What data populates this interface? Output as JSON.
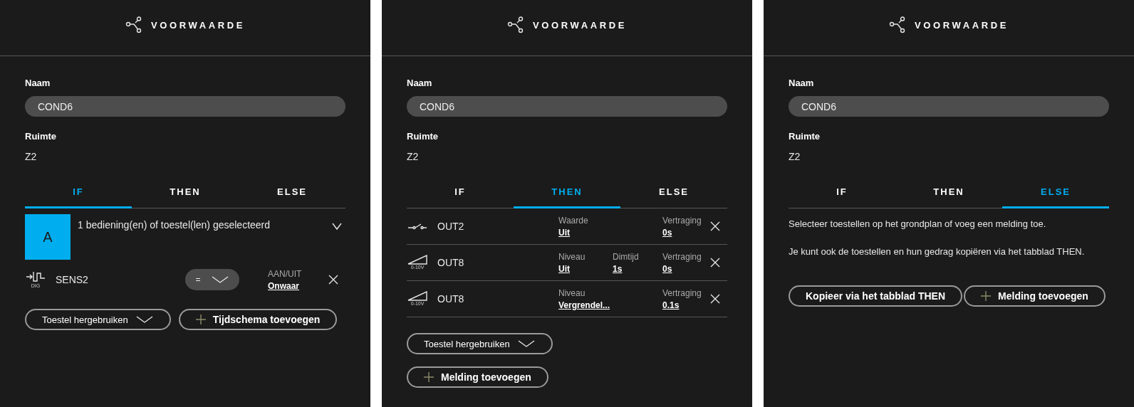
{
  "panels": [
    {
      "kind": "if",
      "title": "VOORWAARDE",
      "name_label": "Naam",
      "name": "COND6",
      "room_label": "Ruimte",
      "room": "Z2",
      "tabs": [
        {
          "label": "IF",
          "selected": true
        },
        {
          "label": "THEN",
          "selected": false
        },
        {
          "label": "ELSE",
          "selected": false
        }
      ],
      "group": {
        "badge": "A",
        "title": "1 bediening(en) of toestel(len) geselecteerd"
      },
      "conditions": [
        {
          "kind": "digital",
          "icon_label": "DIG",
          "name": "SENS2",
          "operator": "=",
          "value_label": "AAN/UIT",
          "value": "Onwaar"
        }
      ],
      "buttons": [
        {
          "kind": "dropdown",
          "label": "Toestel hergebruiken"
        },
        {
          "kind": "add",
          "label": "Tijdschema toevoegen"
        }
      ]
    },
    {
      "kind": "then",
      "title": "VOORWAARDE",
      "name_label": "Naam",
      "name": "COND6",
      "room_label": "Ruimte",
      "room": "Z2",
      "tabs": [
        {
          "label": "IF",
          "selected": false
        },
        {
          "label": "THEN",
          "selected": true
        },
        {
          "label": "ELSE",
          "selected": false
        }
      ],
      "actions": [
        {
          "kind": "switch",
          "name": "OUT2",
          "primary": {
            "label": "Waarde",
            "value": "Uit"
          },
          "delay": {
            "label": "Vertraging",
            "value": "0s"
          }
        },
        {
          "kind": "dimmer",
          "icon_label": "0-10V",
          "name": "OUT8",
          "primary": {
            "label": "Niveau",
            "value": "Uit"
          },
          "dimtime": {
            "label": "Dimtijd",
            "value": "1s"
          },
          "delay": {
            "label": "Vertraging",
            "value": "0s"
          }
        },
        {
          "kind": "dimmer",
          "icon_label": "0-10V",
          "name": "OUT8",
          "primary": {
            "label": "Niveau",
            "value": "Vergrendel..."
          },
          "delay": {
            "label": "Vertraging",
            "value": "0.1s"
          }
        }
      ],
      "buttons": [
        {
          "kind": "dropdown",
          "label": "Toestel hergebruiken"
        },
        {
          "kind": "add",
          "label": "Melding toevoegen"
        }
      ]
    },
    {
      "kind": "else",
      "title": "VOORWAARDE",
      "name_label": "Naam",
      "name": "COND6",
      "room_label": "Ruimte",
      "room": "Z2",
      "tabs": [
        {
          "label": "IF",
          "selected": false
        },
        {
          "label": "THEN",
          "selected": false
        },
        {
          "label": "ELSE",
          "selected": true
        }
      ],
      "paragraphs": [
        "Selecteer toestellen op het grondplan of voeg een melding toe.",
        "Je kunt ook de toestellen en hun gedrag kopiëren via het tabblad THEN."
      ],
      "buttons": [
        {
          "kind": "plain",
          "label": "Kopieer via het tabblad THEN"
        },
        {
          "kind": "add",
          "label": "Melding toevoegen"
        }
      ]
    }
  ]
}
